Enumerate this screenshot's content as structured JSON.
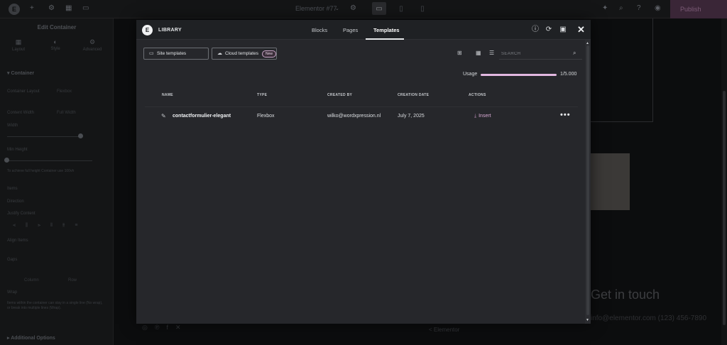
{
  "topbar": {
    "doc_title": "Elementor #77",
    "publish_label": "Publish"
  },
  "panel": {
    "title": "Edit Container",
    "tabs": [
      {
        "label": "Layout",
        "icon": "layout-icon"
      },
      {
        "label": "Style",
        "icon": "style-icon"
      },
      {
        "label": "Advanced",
        "icon": "gear-icon"
      }
    ],
    "section_container": "Container",
    "container_layout_label": "Container Layout",
    "container_layout_value": "Flexbox",
    "content_width_label": "Content Width",
    "content_width_value": "Full Width",
    "width_label": "Width",
    "min_height_label": "Min Height",
    "min_height_hint": "To achieve full height Container use 100vh",
    "items_label": "Items",
    "direction_label": "Direction",
    "justify_label": "Justify Content",
    "align_label": "Align Items",
    "gaps_label": "Gaps",
    "gaps_sub": [
      "Column",
      "Row"
    ],
    "wrap_label": "Wrap",
    "wrap_hint": "Items within the container can stay in a single line (No wrap), or break into multiple lines (Wrap).",
    "additional_options": "Additional Options"
  },
  "preview": {
    "heading": "Get in touch",
    "contact_line": "info@elementor.com (123) 456-7890",
    "footer_text": "< Elementor"
  },
  "library": {
    "title": "LIBRARY",
    "tabs": [
      "Blocks",
      "Pages",
      "Templates"
    ],
    "active_tab": "Templates",
    "site_templates_label": "Site templates",
    "cloud_templates_label": "Cloud templates",
    "new_badge": "New",
    "search_placeholder": "SEARCH",
    "usage_label": "Usage",
    "usage_value": "1/5.000",
    "usage_fraction": 0.0002,
    "columns": [
      "NAME",
      "TYPE",
      "CREATED BY",
      "CREATION DATE",
      "ACTIONS"
    ],
    "rows": [
      {
        "name": "contactformulier-elegant",
        "type": "Flexbox",
        "created_by": "wilko@wordxpression.nl",
        "creation_date": "July 7, 2025",
        "action": "Insert"
      }
    ]
  }
}
